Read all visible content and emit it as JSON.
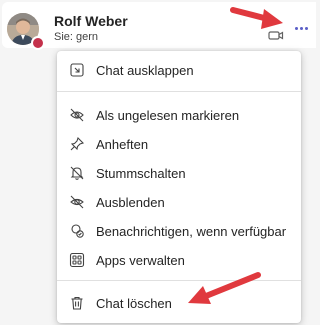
{
  "chat": {
    "name": "Rolf Weber",
    "status": "Sie: gern",
    "presence": "busy"
  },
  "menu": {
    "items": [
      {
        "label": "Chat ausklappen",
        "icon": "expand-icon"
      },
      {
        "label": "Als ungelesen markieren",
        "icon": "unread-icon"
      },
      {
        "label": "Anheften",
        "icon": "pin-icon"
      },
      {
        "label": "Stummschalten",
        "icon": "mute-bell-icon"
      },
      {
        "label": "Ausblenden",
        "icon": "hide-eye-icon"
      },
      {
        "label": "Benachrichtigen, wenn verfügbar",
        "icon": "notify-available-icon"
      },
      {
        "label": "Apps verwalten",
        "icon": "apps-grid-icon"
      },
      {
        "label": "Chat löschen",
        "icon": "trash-icon"
      }
    ]
  },
  "colors": {
    "accent": "#5b5fc7",
    "presence_busy": "#c4314b",
    "annotation_arrow": "#e0393e"
  }
}
